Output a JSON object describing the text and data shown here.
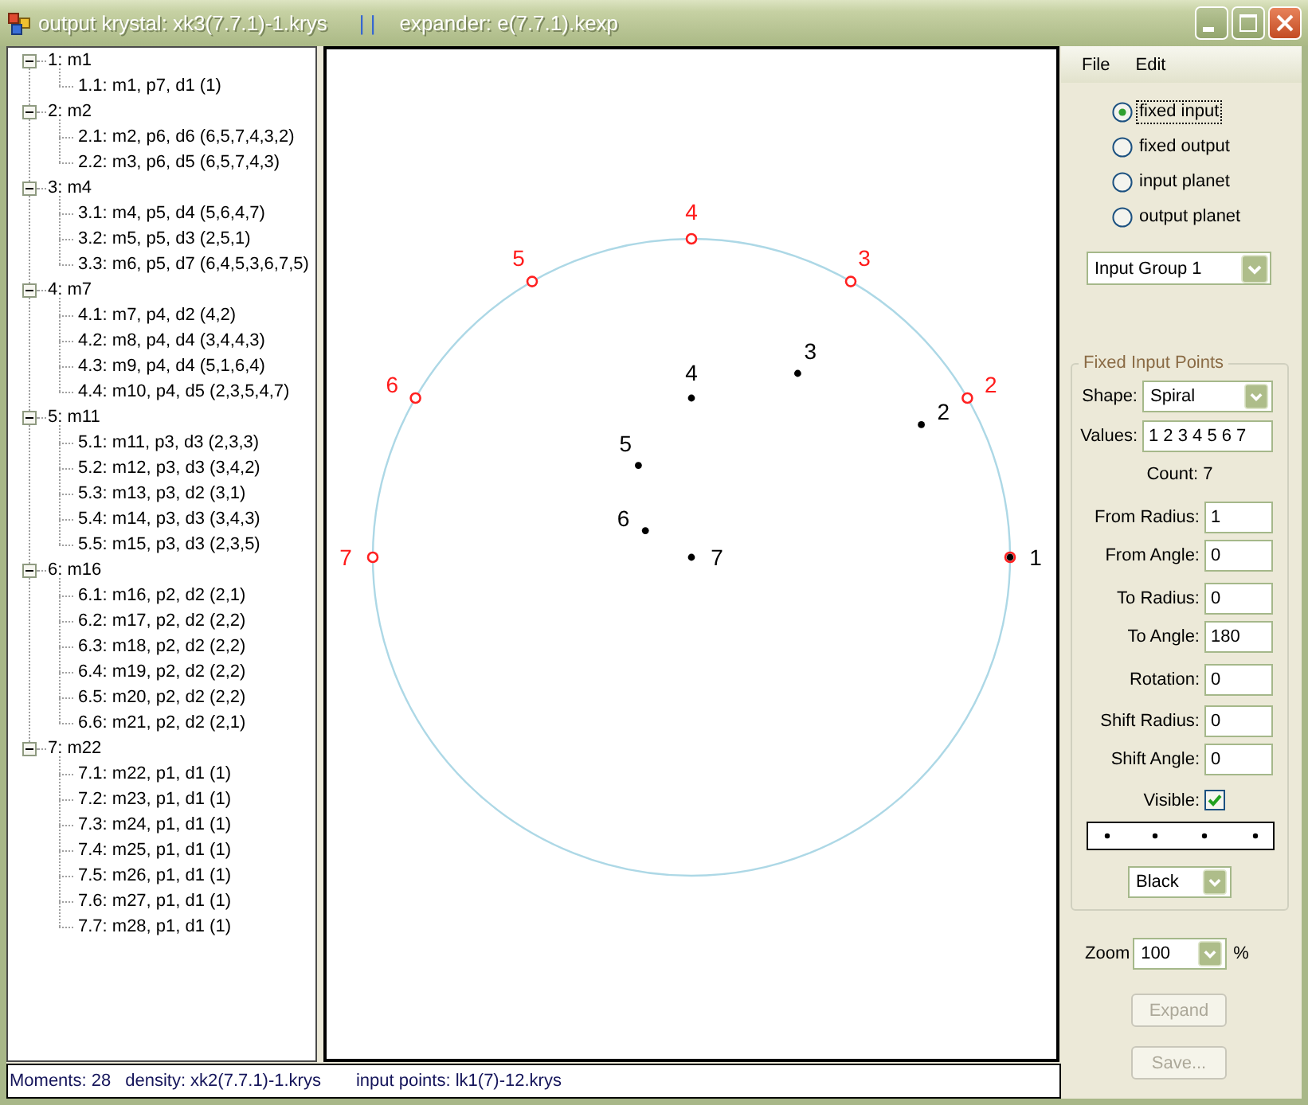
{
  "window": {
    "title": "output krystal: xk3(7.7.1)-1.krys",
    "title_separator": "| |",
    "title_extra": "expander: e(7.7.1).kexp"
  },
  "tree": {
    "items": [
      {
        "label": "1: m1",
        "expanded": true,
        "children": [
          {
            "label": "1.1: m1, p7, d1 (1)"
          }
        ]
      },
      {
        "label": "2: m2",
        "expanded": true,
        "children": [
          {
            "label": "2.1: m2, p6, d6 (6,5,7,4,3,2)"
          },
          {
            "label": "2.2: m3, p6, d5 (6,5,7,4,3)"
          }
        ]
      },
      {
        "label": "3: m4",
        "expanded": true,
        "children": [
          {
            "label": "3.1: m4, p5, d4 (5,6,4,7)"
          },
          {
            "label": "3.2: m5, p5, d3 (2,5,1)"
          },
          {
            "label": "3.3: m6, p5, d7 (6,4,5,3,6,7,5)"
          }
        ]
      },
      {
        "label": "4: m7",
        "expanded": true,
        "children": [
          {
            "label": "4.1: m7, p4, d2 (4,2)"
          },
          {
            "label": "4.2: m8, p4, d4 (3,4,4,3)"
          },
          {
            "label": "4.3: m9, p4, d4 (5,1,6,4)"
          },
          {
            "label": "4.4: m10, p4, d5 (2,3,5,4,7)"
          }
        ]
      },
      {
        "label": "5: m11",
        "expanded": true,
        "children": [
          {
            "label": "5.1: m11, p3, d3 (2,3,3)"
          },
          {
            "label": "5.2: m12, p3, d3 (3,4,2)"
          },
          {
            "label": "5.3: m13, p3, d2 (3,1)"
          },
          {
            "label": "5.4: m14, p3, d3 (3,4,3)"
          },
          {
            "label": "5.5: m15, p3, d3 (2,3,5)"
          }
        ]
      },
      {
        "label": "6: m16",
        "expanded": true,
        "children": [
          {
            "label": "6.1: m16, p2, d2 (2,1)"
          },
          {
            "label": "6.2: m17, p2, d2 (2,2)"
          },
          {
            "label": "6.3: m18, p2, d2 (2,2)"
          },
          {
            "label": "6.4: m19, p2, d2 (2,2)"
          },
          {
            "label": "6.5: m20, p2, d2 (2,2)"
          },
          {
            "label": "6.6: m21, p2, d2 (2,1)"
          }
        ]
      },
      {
        "label": "7: m22",
        "expanded": true,
        "children": [
          {
            "label": "7.1: m22, p1, d1 (1)"
          },
          {
            "label": "7.2: m23, p1, d1 (1)"
          },
          {
            "label": "7.3: m24, p1, d1 (1)"
          },
          {
            "label": "7.4: m25, p1, d1 (1)"
          },
          {
            "label": "7.5: m26, p1, d1 (1)"
          },
          {
            "label": "7.6: m27, p1, d1 (1)"
          },
          {
            "label": "7.7: m28, p1, d1 (1)"
          }
        ]
      }
    ]
  },
  "canvas": {
    "ring_labels": [
      "2",
      "3",
      "4",
      "5",
      "6",
      "7"
    ],
    "spiral_points": [
      {
        "label": "1"
      },
      {
        "label": "2"
      },
      {
        "label": "3"
      },
      {
        "label": "4"
      },
      {
        "label": "5"
      },
      {
        "label": "6"
      },
      {
        "label": "7"
      }
    ]
  },
  "menu": [
    "File",
    "Edit"
  ],
  "modes": [
    {
      "label": "fixed input",
      "selected": true
    },
    {
      "label": "fixed output",
      "selected": false
    },
    {
      "label": "input planet",
      "selected": false
    },
    {
      "label": "output planet",
      "selected": false
    }
  ],
  "group_select": {
    "value": "Input Group 1"
  },
  "fixed_input_points": {
    "title": "Fixed Input Points",
    "shape": {
      "label": "Shape:",
      "value": "Spiral"
    },
    "values": {
      "label": "Values:",
      "value": "1 2 3 4 5 6 7"
    },
    "count": "Count: 7",
    "params": [
      {
        "label": "From Radius:",
        "value": "1"
      },
      {
        "label": "From Angle:",
        "value": "0"
      },
      {
        "label": "To Radius:",
        "value": "0"
      },
      {
        "label": "To Angle:",
        "value": "180"
      },
      {
        "label": "Rotation:",
        "value": "0"
      },
      {
        "label": "Shift Radius:",
        "value": "0"
      },
      {
        "label": "Shift Angle:",
        "value": "0"
      }
    ],
    "visible": {
      "label": "Visible:",
      "checked": true
    },
    "color": {
      "value": "Black"
    }
  },
  "zoom": {
    "label": "Zoom",
    "value": "100",
    "unit": "%"
  },
  "buttons": [
    {
      "label": "Expand",
      "disabled": true
    },
    {
      "label": "Save...",
      "disabled": true
    }
  ],
  "status_bar": [
    "Moments: 28",
    "density: xk2(7.7.1)-1.krys",
    "input points: lk1(7)-12.krys"
  ]
}
